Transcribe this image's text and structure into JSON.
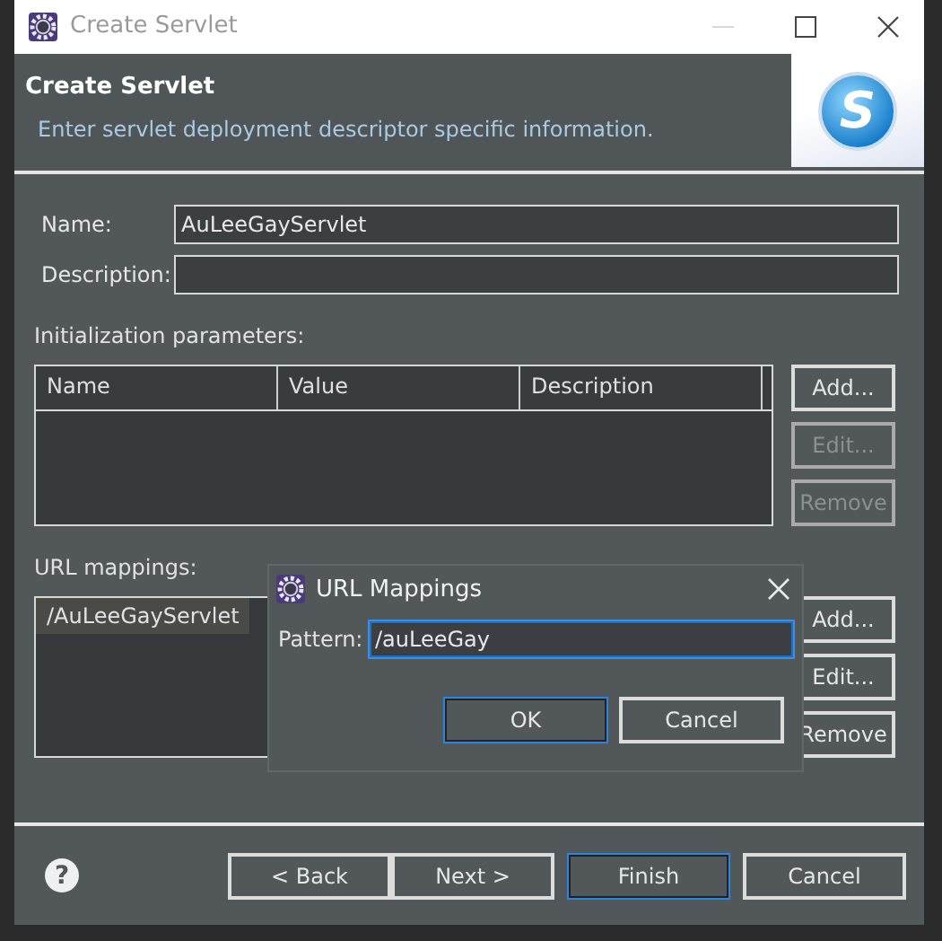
{
  "window": {
    "title": "Create Servlet"
  },
  "header": {
    "title": "Create Servlet",
    "description": "Enter servlet deployment descriptor specific information.",
    "logo_text": "S"
  },
  "fields": [
    {
      "label": "Name:",
      "value": "AuLeeGayServlet"
    },
    {
      "label": "Description:"
    }
  ],
  "init_parameters": {
    "label": "Initialization parameters:",
    "columns": [
      "Name",
      "Value",
      "Description"
    ],
    "buttons": [
      {
        "label": "Add...",
        "disabled": false
      },
      {
        "label": "Edit...",
        "disabled": true
      },
      {
        "label": "Remove",
        "disabled": true
      }
    ]
  },
  "url_mappings": {
    "label": "URL mappings:",
    "items": [
      {
        "text": "/AuLeeGayServlet",
        "selected": true
      }
    ],
    "buttons": [
      {
        "label": "Add...",
        "disabled": false
      },
      {
        "label": "Edit...",
        "disabled": false
      },
      {
        "label": "Remove",
        "disabled": false
      }
    ]
  },
  "mapping_dialog": {
    "title": "URL Mappings",
    "pattern_label": "Pattern:",
    "pattern_value": "/auLeeGay",
    "buttons": [
      {
        "label": "OK",
        "default": true
      },
      {
        "label": "Cancel",
        "default": false
      }
    ]
  },
  "footer": {
    "help": "?",
    "buttons": [
      {
        "label": "< Back",
        "default": false
      },
      {
        "label": "Next >",
        "default": false
      },
      {
        "label": "Finish",
        "default": true
      },
      {
        "label": "Cancel",
        "default": false
      }
    ]
  }
}
